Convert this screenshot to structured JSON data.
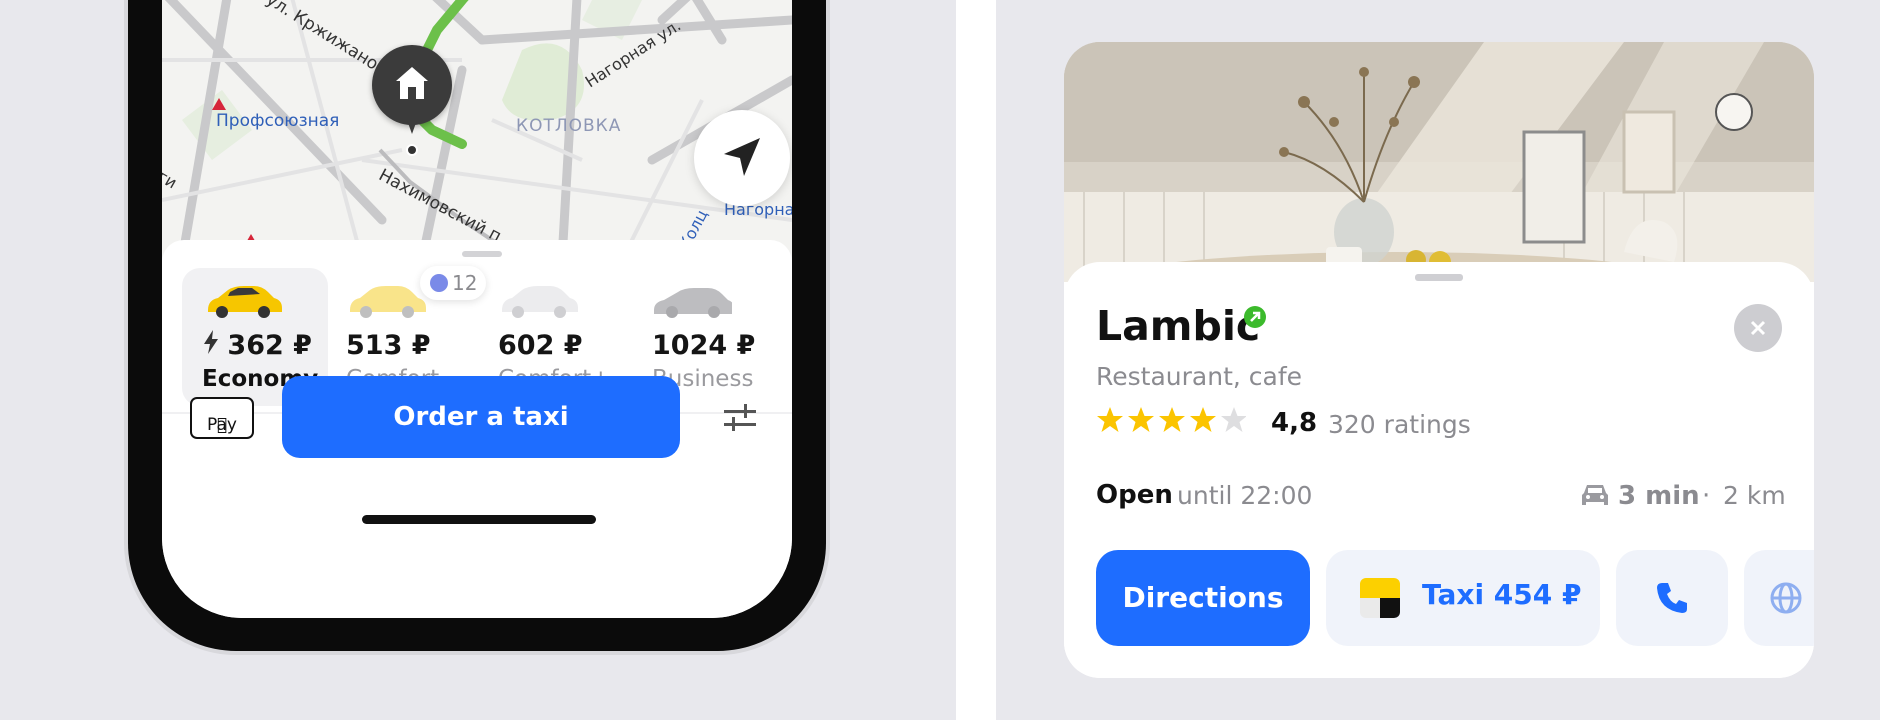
{
  "map": {
    "labels": {
      "street_krzh": "ул. Кржижано",
      "metro_prof": "Профсоюзная",
      "district": "КОТЛОВКА",
      "street_nagornaya": "Нагорная ул.",
      "nakhimovsky": "Нахимовский п",
      "nagorna_station": "Нагорна",
      "kolts": "Колц",
      "edge_left": "ги"
    },
    "route_color": "#6cc04a"
  },
  "tariffs": [
    {
      "price": "362 ₽",
      "name": "Economy",
      "selected": true,
      "color": "#f6c600"
    },
    {
      "price": "513 ₽",
      "name": "Comfort",
      "selected": false,
      "color": "#f9e48a"
    },
    {
      "price": "602 ₽",
      "name": "Comfort+",
      "selected": false,
      "color": "#e9e9ea"
    },
    {
      "price": "1024 ₽",
      "name": "Business",
      "selected": false,
      "color": "#bdbdc0"
    }
  ],
  "surge": {
    "value": "12"
  },
  "payment": {
    "label": "Pay"
  },
  "order": {
    "label": "Order a taxi",
    "color": "#1e6dff"
  },
  "place": {
    "name": "Lambic",
    "category": "Restaurant, cafe",
    "stars": 4,
    "rating": "4,8",
    "ratings_count": "320 ratings",
    "status": "Open",
    "hours": "until 22:00",
    "eta": "3 min",
    "separator": "·",
    "distance": "2 km"
  },
  "actions": {
    "directions": "Directions",
    "taxi": "Taxi 454 ₽"
  }
}
